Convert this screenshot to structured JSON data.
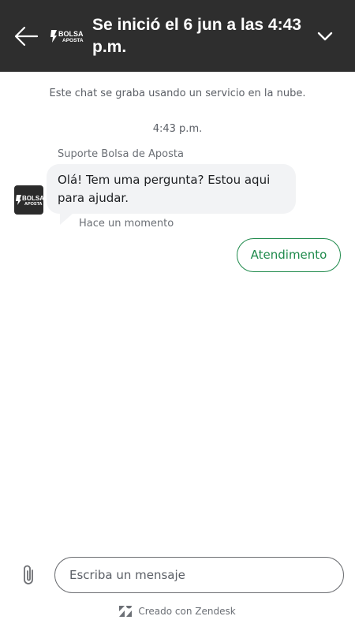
{
  "header": {
    "title": "Se inició el 6 jun a las 4:43 p.m.",
    "logo_line1": "BOLSA",
    "logo_line2": "APOSTA",
    "bg_color": "#2e2e2e"
  },
  "chat": {
    "recording_notice": "Este chat se graba usando un servicio en la nube.",
    "timestamp": "4:43 p.m.",
    "messages": [
      {
        "sender": "Suporte Bolsa de Aposta",
        "text": "Olá! Tem uma pergunta? Estou aqui para ajudar.",
        "time": "Hace un momento"
      }
    ],
    "quick_replies": [
      {
        "label": "Atendimento",
        "color": "#1f8a4c"
      }
    ]
  },
  "composer": {
    "placeholder": "Escriba un mensaje",
    "value": ""
  },
  "footer": {
    "label": "Creado con Zendesk"
  },
  "icons": {
    "back": "back-arrow-icon",
    "collapse": "chevron-down-icon",
    "attach": "paperclip-icon",
    "zendesk": "zendesk-logo-icon"
  }
}
